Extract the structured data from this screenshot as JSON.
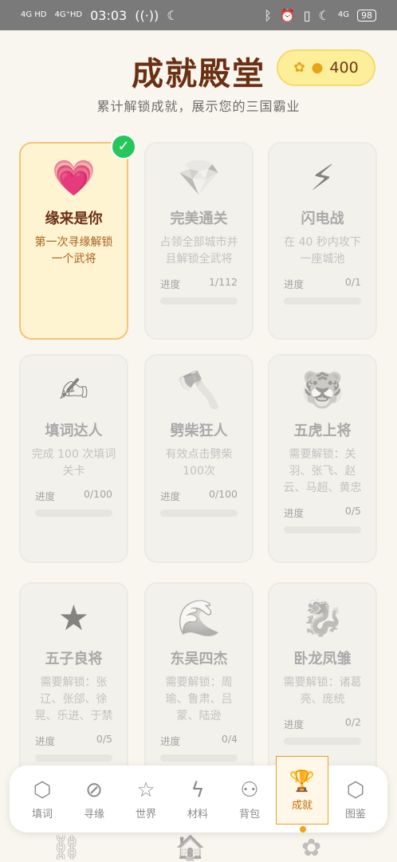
{
  "status_bar": {
    "signal_1": "4G HD",
    "signal_2": "4G⁺HD",
    "time": "03:03",
    "battery": "98",
    "network": "4G"
  },
  "header": {
    "title": "成就殿堂",
    "coins": "400",
    "subtitle": "累计解锁成就，展示您的三国霸业"
  },
  "achievements": [
    {
      "icon": "heart-icon",
      "emoji": "💗",
      "name": "缘来是你",
      "desc": "第一次寻缘解锁一个武将",
      "unlocked": true
    },
    {
      "icon": "diamond-icon",
      "emoji": "💎",
      "name": "完美通关",
      "desc": "占领全部城市并且解锁全武将",
      "progress_label": "进度",
      "progress": "1/112"
    },
    {
      "icon": "lightning-icon",
      "emoji": "⚡",
      "name": "闪电战",
      "desc": "在 40 秒内攻下一座城池",
      "progress_label": "进度",
      "progress": "0/1"
    },
    {
      "icon": "writing-hand-icon",
      "emoji": "✍",
      "name": "填词达人",
      "desc": "完成 100 次填词关卡",
      "progress_label": "进度",
      "progress": "0/100"
    },
    {
      "icon": "axe-icon",
      "emoji": "🪓",
      "name": "劈柴狂人",
      "desc": "有效点击劈柴100次",
      "progress_label": "进度",
      "progress": "0/100"
    },
    {
      "icon": "tiger-icon",
      "emoji": "🐯",
      "name": "五虎上将",
      "desc": "需要解锁：关羽、张飞、赵云、马超、黄忠",
      "progress_label": "进度",
      "progress": "0/5"
    },
    {
      "icon": "star-icon",
      "emoji": "★",
      "name": "五子良将",
      "desc": "需要解锁：张辽、张郃、徐晃、乐进、于禁",
      "progress_label": "进度",
      "progress": "0/5"
    },
    {
      "icon": "wave-icon",
      "emoji": "🌊",
      "name": "东吴四杰",
      "desc": "需要解锁：周瑜、鲁肃、吕蒙、陆逊",
      "progress_label": "进度",
      "progress": "0/4"
    },
    {
      "icon": "dragon-icon",
      "emoji": "🐉",
      "name": "卧龙凤雏",
      "desc": "需要解锁：诸葛亮、庞统",
      "progress_label": "进度",
      "progress": "0/2"
    }
  ],
  "nav": [
    {
      "label": "填词",
      "icon": "cube-icon",
      "glyph": "⬡"
    },
    {
      "label": "寻缘",
      "icon": "compass-icon",
      "glyph": "⊘"
    },
    {
      "label": "世界",
      "icon": "star-outline-icon",
      "glyph": "☆"
    },
    {
      "label": "材料",
      "icon": "bolt-icon",
      "glyph": "ϟ"
    },
    {
      "label": "背包",
      "icon": "coins-icon",
      "glyph": "⚇"
    },
    {
      "label": "成就",
      "icon": "trophy-icon",
      "glyph": "🏆",
      "active": true
    },
    {
      "label": "图鉴",
      "icon": "box-icon",
      "glyph": "⬡"
    }
  ]
}
